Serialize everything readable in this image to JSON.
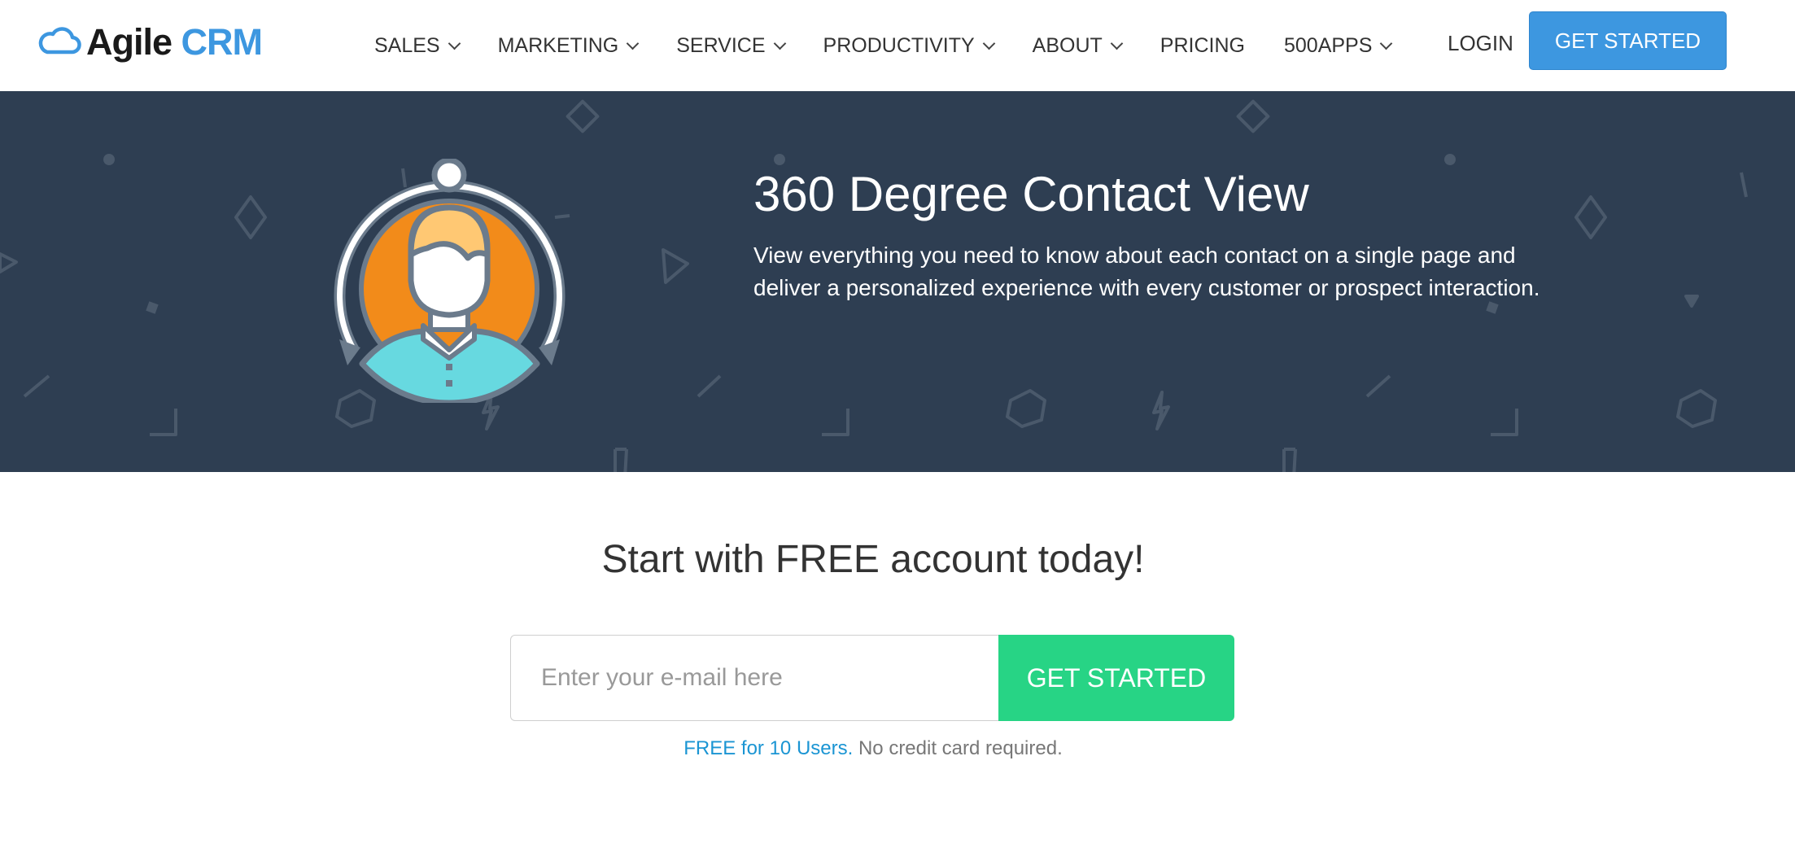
{
  "brand": {
    "name_part1": "Agile",
    "name_part2": "CRM",
    "accent": "#3d97e0"
  },
  "nav": {
    "items": [
      {
        "label": "SALES",
        "has_dropdown": true
      },
      {
        "label": "MARKETING",
        "has_dropdown": true
      },
      {
        "label": "SERVICE",
        "has_dropdown": true
      },
      {
        "label": "PRODUCTIVITY",
        "has_dropdown": true
      },
      {
        "label": "ABOUT",
        "has_dropdown": true
      },
      {
        "label": "PRICING",
        "has_dropdown": false
      },
      {
        "label": "500APPS",
        "has_dropdown": true
      }
    ],
    "login_label": "LOGIN",
    "cta_label": "GET STARTED"
  },
  "hero": {
    "title": "360 Degree Contact View",
    "description": "View everything you need to know about each contact on a single page and deliver a personalized experience with every customer or prospect interaction.",
    "background": "#2e3e52",
    "icon": "contact-avatar-icon"
  },
  "signup": {
    "title": "Start with FREE account today!",
    "email_placeholder": "Enter your e-mail here",
    "button_label": "GET STARTED",
    "button_color": "#27d485",
    "note_link": "FREE for 10 Users.",
    "note_text": " No credit card required."
  }
}
